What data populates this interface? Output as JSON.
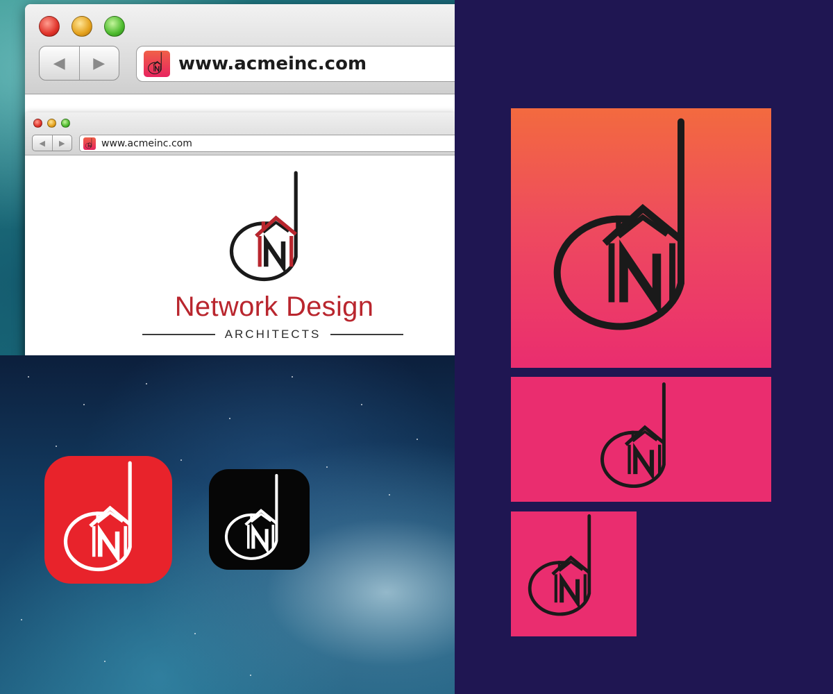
{
  "browser": {
    "url": "www.acmeinc.com",
    "inner_url": "www.acmeinc.com",
    "back_icon": "back-arrow-icon",
    "forward_icon": "forward-arrow-icon"
  },
  "brand": {
    "name": "Network Design",
    "subtitle": "ARCHITECTS",
    "logo_icon": "dn-house-logo-icon"
  },
  "colors": {
    "brand_red": "#b9262e",
    "app_red": "#e8232b",
    "card_pink": "#ea2d6f",
    "card_orange": "#f36a3f",
    "navy": "#1f1652",
    "logo_dark": "#1a1a1a"
  },
  "app_icons": [
    {
      "name": "red-app-icon",
      "background": "#e8232b"
    },
    {
      "name": "black-app-icon",
      "background": "#060606"
    }
  ],
  "cards": [
    {
      "name": "large-gradient-card"
    },
    {
      "name": "medium-pink-card"
    },
    {
      "name": "small-pink-card"
    }
  ]
}
